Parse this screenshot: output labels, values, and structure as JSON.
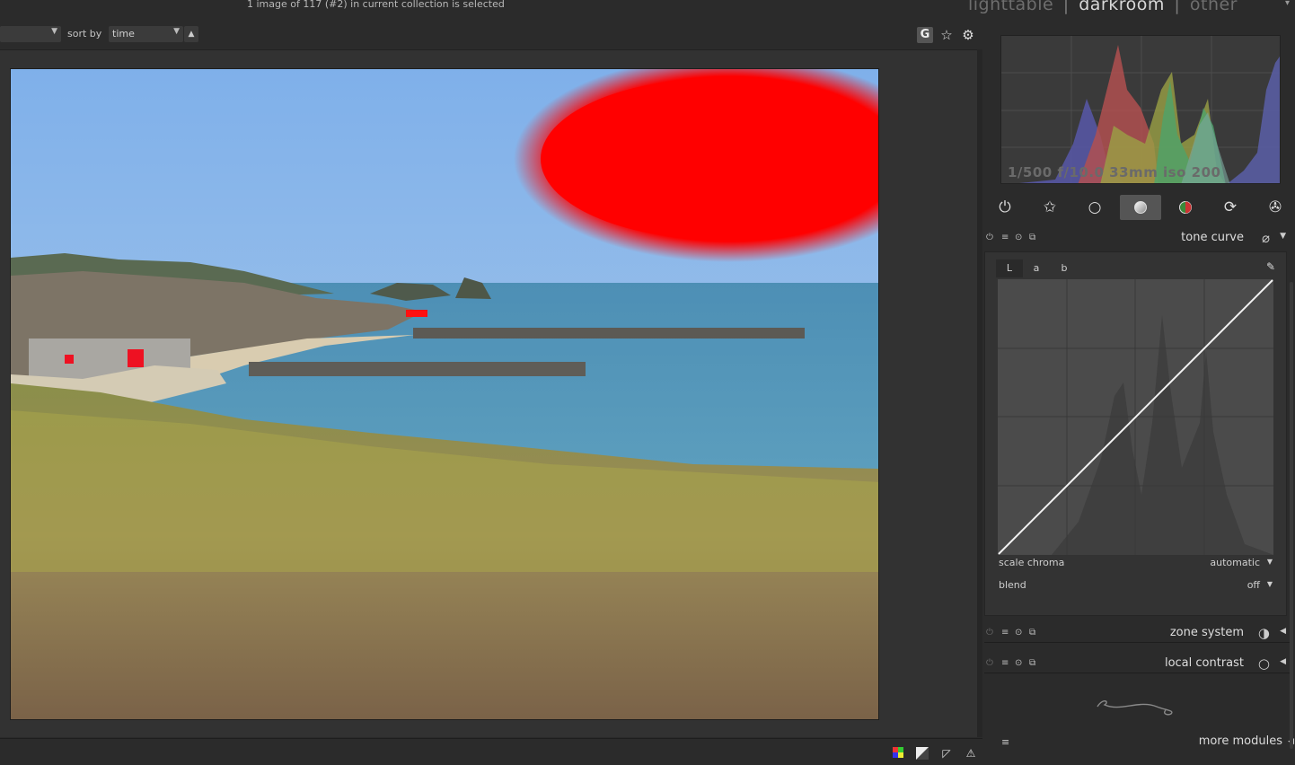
{
  "header": {
    "selection_info": "1 image of 117 (#2) in current collection is selected",
    "views": [
      "lighttable",
      "darkroom",
      "other"
    ],
    "active_view": "darkroom",
    "separator": "|",
    "dropdown_arrow": "▾"
  },
  "filterbar": {
    "collection_dropdown_value": "",
    "sort_label": "sort by",
    "sort_value": "time",
    "sort_direction_icon": "▲",
    "grouping_button": "G",
    "star_icon": "☆",
    "gear_icon": "⚙"
  },
  "histogram": {
    "exif": "1/500 f/10.0 33mm iso 200"
  },
  "module_groups": [
    {
      "name": "power-icon",
      "glyph": "⏻"
    },
    {
      "name": "favorites-icon",
      "glyph": "✩"
    },
    {
      "name": "basic-group-icon",
      "glyph": "○"
    },
    {
      "name": "tone-group-icon",
      "glyph": "●"
    },
    {
      "name": "color-group-icon",
      "glyph": "◉"
    },
    {
      "name": "correct-group-icon",
      "glyph": "⟳"
    },
    {
      "name": "effect-group-icon",
      "glyph": "✇"
    }
  ],
  "tone_curve": {
    "title": "tone curve",
    "tabs": [
      "L",
      "a",
      "b"
    ],
    "active_tab": "L",
    "scale_chroma_label": "scale chroma",
    "scale_chroma_value": "automatic",
    "blend_label": "blend",
    "blend_value": "off"
  },
  "modules": [
    {
      "title": "zone system"
    },
    {
      "title": "local contrast"
    }
  ],
  "footer": {
    "more_modules": "more modules"
  },
  "colors": {
    "overexposure_indicator": "#ff0000",
    "panel_bg": "#2b2b2b",
    "center_bg": "#323232",
    "active_view": "#d8d8d8"
  }
}
